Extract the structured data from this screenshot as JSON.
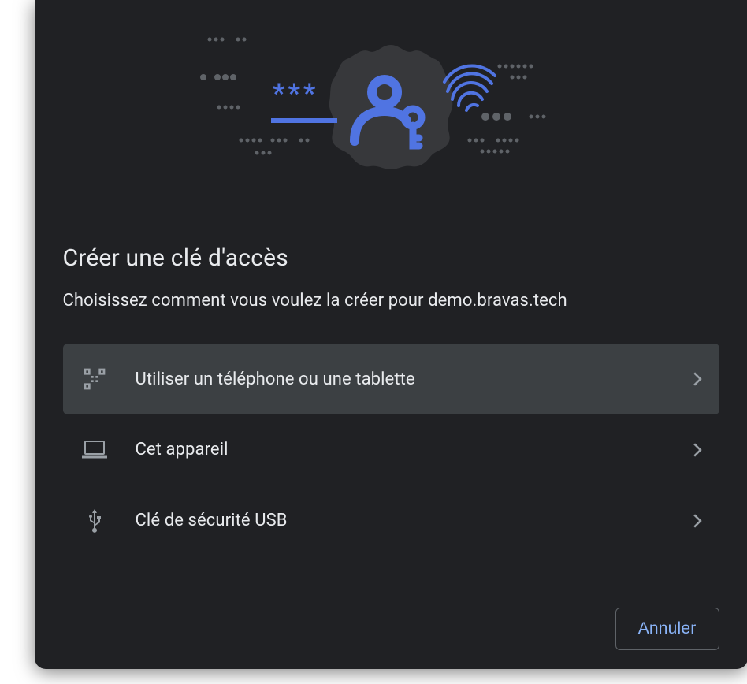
{
  "title": "Créer une clé d'accès",
  "subtitle": "Choisissez comment vous voulez la créer pour demo.bravas.tech",
  "options": [
    {
      "label": "Utiliser un téléphone ou une tablette"
    },
    {
      "label": "Cet appareil"
    },
    {
      "label": "Clé de sécurité USB"
    }
  ],
  "footer": {
    "cancel": "Annuler"
  },
  "colors": {
    "accent": "#5074e2",
    "accent_light": "#8ab4f8",
    "bg": "#202124"
  }
}
